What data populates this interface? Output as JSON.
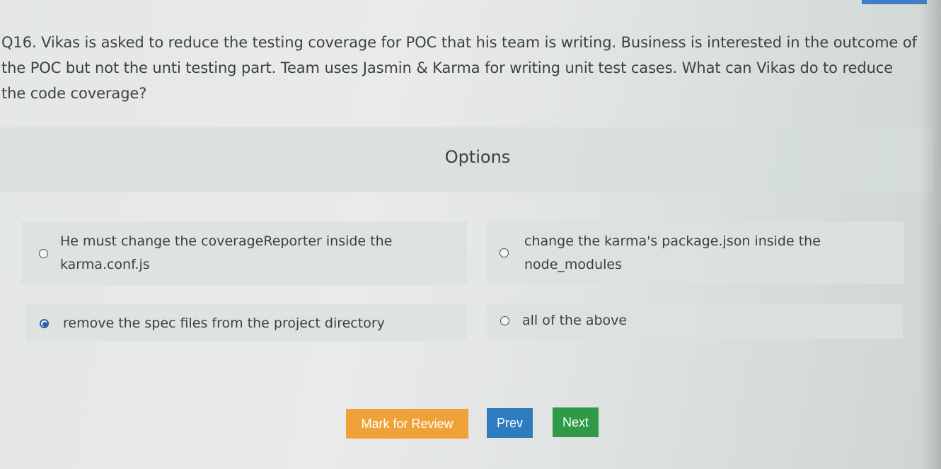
{
  "question": {
    "line1": "Q16. Vikas is asked to reduce the testing coverage for POC that his team is writing. Business is interested in the outcome of",
    "line2": "the POC but not the unti testing part. Team uses Jasmin & Karma for writing unit test cases. What can Vikas do to reduce",
    "line3": "the code coverage?"
  },
  "options": {
    "title": "Options",
    "items": [
      {
        "line1": "He must change the coverageReporter inside the",
        "line2": "karma.conf.js",
        "selected": false
      },
      {
        "line1": "change the karma's package.json inside the",
        "line2": "node_modules",
        "selected": false
      },
      {
        "line1": "remove the spec files from the project directory",
        "selected": true
      },
      {
        "line1": "all of the above",
        "selected": false
      }
    ]
  },
  "buttons": {
    "mark_for_review": "Mark for Review",
    "prev": "Prev",
    "next": "Next"
  },
  "colors": {
    "accent": "#3f7fc4",
    "mark_for_review": "#f0a23a",
    "prev": "#2e7cc0",
    "next": "#2f9a45",
    "radio_selected": "#2a5fa8"
  }
}
